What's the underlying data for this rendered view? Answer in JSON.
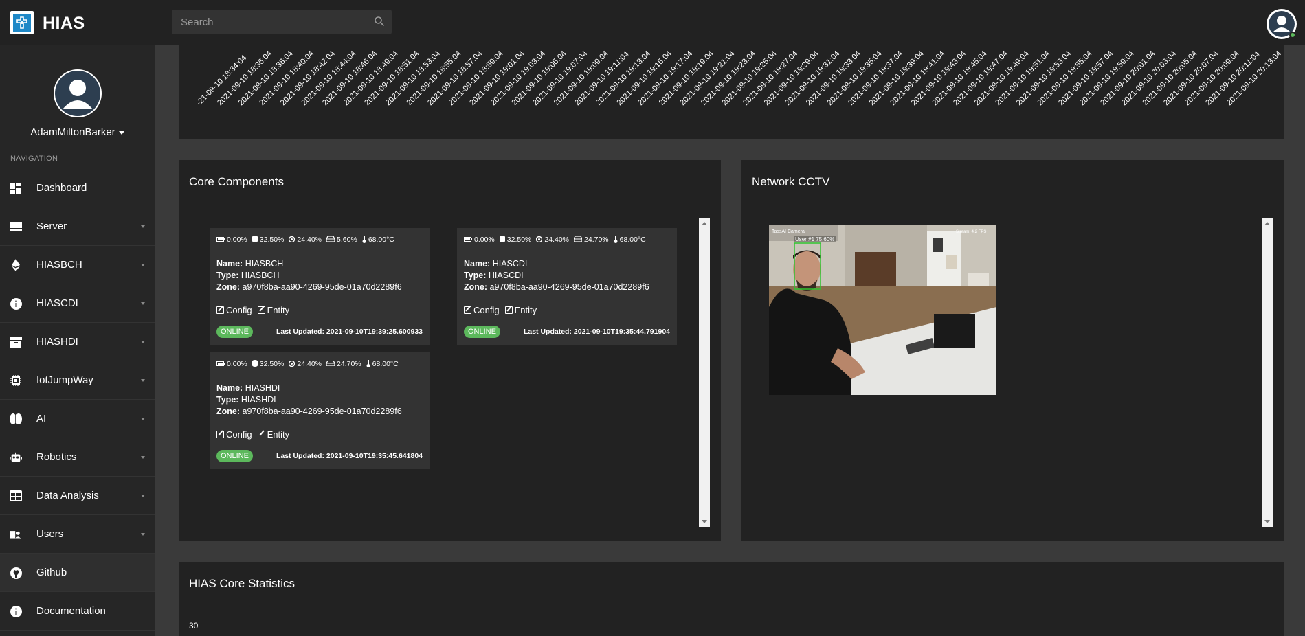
{
  "app": {
    "brand": "HIAS"
  },
  "search": {
    "placeholder": "Search"
  },
  "user": {
    "name": "AdamMiltonBarker"
  },
  "sidebar": {
    "heading": "NAVIGATION",
    "items": [
      {
        "label": "Dashboard",
        "icon": "dashboard-icon",
        "caret": false
      },
      {
        "label": "Server",
        "icon": "server-icon",
        "caret": true
      },
      {
        "label": "HIASBCH",
        "icon": "ethereum-icon",
        "caret": true
      },
      {
        "label": "HIASCDI",
        "icon": "info-icon",
        "caret": true
      },
      {
        "label": "HIASHDI",
        "icon": "archive-icon",
        "caret": true
      },
      {
        "label": "IotJumpWay",
        "icon": "chip-icon",
        "caret": true
      },
      {
        "label": "AI",
        "icon": "brain-icon",
        "caret": true
      },
      {
        "label": "Robotics",
        "icon": "robot-icon",
        "caret": true
      },
      {
        "label": "Data Analysis",
        "icon": "table-icon",
        "caret": true
      },
      {
        "label": "Users",
        "icon": "users-icon",
        "caret": true
      },
      {
        "label": "Github",
        "icon": "github-icon",
        "caret": false
      },
      {
        "label": "Documentation",
        "icon": "info-icon",
        "caret": false
      }
    ]
  },
  "timeline": {
    "labels": [
      "-21-09-10 18:34:04",
      "2021-09-10 18:36:04",
      "2021-09-10 18:38:04",
      "2021-09-10 18:40:04",
      "2021-09-10 18:42:04",
      "2021-09-10 18:44:04",
      "2021-09-10 18:46:04",
      "2021-09-10 18:49:04",
      "2021-09-10 18:51:04",
      "2021-09-10 18:53:04",
      "2021-09-10 18:55:04",
      "2021-09-10 18:57:04",
      "2021-09-10 18:59:04",
      "2021-09-10 19:01:04",
      "2021-09-10 19:03:04",
      "2021-09-10 19:05:04",
      "2021-09-10 19:07:04",
      "2021-09-10 19:09:04",
      "2021-09-10 19:11:04",
      "2021-09-10 19:13:04",
      "2021-09-10 19:15:04",
      "2021-09-10 19:17:04",
      "2021-09-10 19:19:04",
      "2021-09-10 19:21:04",
      "2021-09-10 19:23:04",
      "2021-09-10 19:25:04",
      "2021-09-10 19:27:04",
      "2021-09-10 19:29:04",
      "2021-09-10 19:31:04",
      "2021-09-10 19:33:04",
      "2021-09-10 19:35:04",
      "2021-09-10 19:37:04",
      "2021-09-10 19:39:04",
      "2021-09-10 19:41:04",
      "2021-09-10 19:43:04",
      "2021-09-10 19:45:04",
      "2021-09-10 19:47:04",
      "2021-09-10 19:49:04",
      "2021-09-10 19:51:04",
      "2021-09-10 19:53:04",
      "2021-09-10 19:55:04",
      "2021-09-10 19:57:04",
      "2021-09-10 19:59:04",
      "2021-09-10 20:01:04",
      "2021-09-10 20:03:04",
      "2021-09-10 20:05:04",
      "2021-09-10 20:07:04",
      "2021-09-10 20:09:04",
      "2021-09-10 20:11:04",
      "2021-09-10 20:13:04"
    ]
  },
  "core": {
    "title": "Core Components",
    "name_label": "Name:",
    "type_label": "Type:",
    "zone_label": "Zone:",
    "config_label": "Config",
    "entity_label": "Entity",
    "components": [
      {
        "battery": "0.00%",
        "cpu": "32.50%",
        "memory": "24.40%",
        "hdd": "5.60%",
        "temp": "68.00°C",
        "name": "HIASBCH",
        "type": "HIASBCH",
        "zone": "a970f8ba-aa90-4269-95de-01a70d2289f6",
        "status": "ONLINE",
        "updated": "Last Updated: 2021-09-10T19:39:25.600933"
      },
      {
        "battery": "0.00%",
        "cpu": "32.50%",
        "memory": "24.40%",
        "hdd": "24.70%",
        "temp": "68.00°C",
        "name": "HIASCDI",
        "type": "HIASCDI",
        "zone": "a970f8ba-aa90-4269-95de-01a70d2289f6",
        "status": "ONLINE",
        "updated": "Last Updated: 2021-09-10T19:35:44.791904"
      },
      {
        "battery": "0.00%",
        "cpu": "32.50%",
        "memory": "24.40%",
        "hdd": "24.70%",
        "temp": "68.00°C",
        "name": "HIASHDI",
        "type": "HIASHDI",
        "zone": "a970f8ba-aa90-4269-95de-01a70d2289f6",
        "status": "ONLINE",
        "updated": "Last Updated: 2021-09-10T19:35:45.641804"
      }
    ]
  },
  "cctv": {
    "title": "Network CCTV",
    "overlay_label": "User #1 75.60%",
    "overlay_title": "TassAI Camera",
    "stream_label": "Stream: 4.2 FPS"
  },
  "stats": {
    "title": "HIAS Core Statistics",
    "y_tick": "30"
  },
  "colors": {
    "online": "#5cb85c",
    "panel": "#222222",
    "background": "#3a3a3a",
    "sidebar": "#262626"
  }
}
